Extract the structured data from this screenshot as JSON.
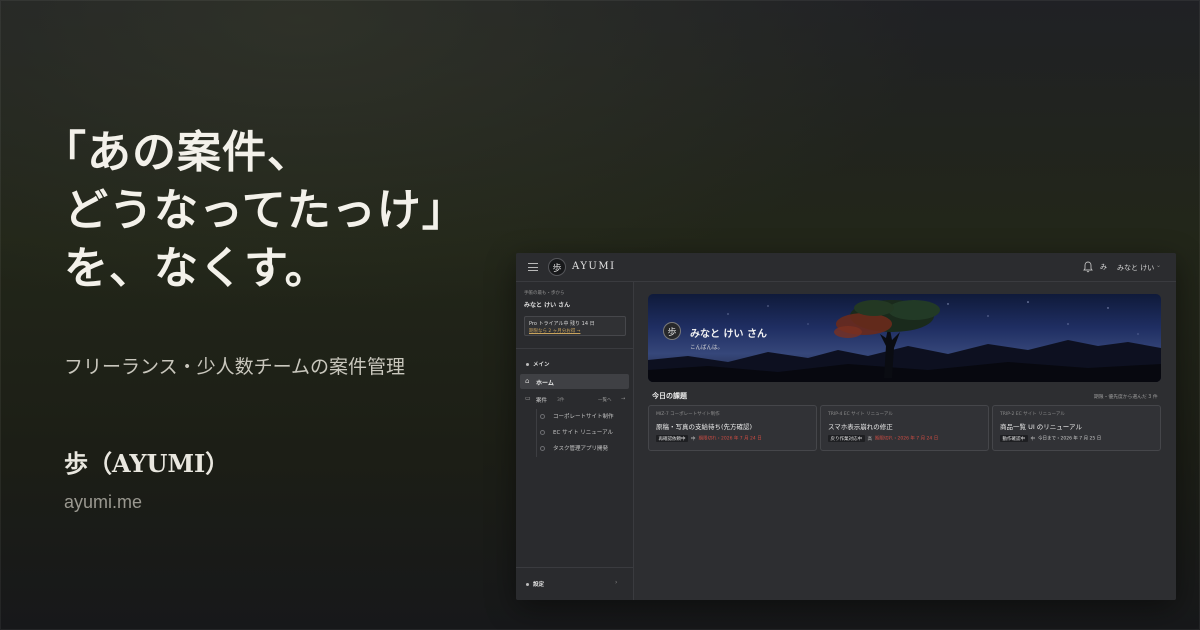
{
  "promo": {
    "headline": [
      "「あの案件、",
      "どうなってたっけ」",
      "を、なくす。"
    ],
    "subtitle": "フリーランス・少人数チームの案件管理",
    "brand": "歩（AYUMI）",
    "url": "ayumi.me"
  },
  "app": {
    "topbar": {
      "logo_glyph": "歩",
      "logo_text": "AYUMI",
      "user_avatar": "み",
      "user_name": "みなと けい"
    },
    "sidebar": {
      "note": "手帳の最も・歩から",
      "user": "みなと けい さん",
      "trial_line1": "Pro トライアル中 残り 14 日",
      "trial_line2": "期限なら 2 ヶ月分お得 →",
      "section_main": "メイン",
      "home_label": "ホーム",
      "cases_label": "案件",
      "cases_count": "3件",
      "cases_all": "一覧へ",
      "cases_add": "→",
      "projects": [
        "コーポレートサイト制作",
        "EC サイト リニューアル",
        "タスク管理アプリ開発"
      ],
      "settings_label": "設定",
      "settings_arrow": "›"
    },
    "hero": {
      "badge": "歩",
      "name": "みなと けい さん",
      "greeting": "こんばんは。"
    },
    "today": {
      "title": "今日の課題",
      "note": "期限・優先度から選んだ 3 件",
      "cards": [
        {
          "project": "MIZ-7 コーポレートサイト制作",
          "title": "原稿・写真の支給待ち(先方確認)",
          "status": "再確認依頼中",
          "priority": "中",
          "due": "期限切れ・2026 年 7 月 24 日"
        },
        {
          "project": "TRIP-4 EC サイト リニューアル",
          "title": "スマホ表示崩れの修正",
          "status": "戻り作業対応中",
          "priority": "高",
          "due": "期限切れ・2026 年 7 月 24 日"
        },
        {
          "project": "TRIP-2 EC サイト リニューアル",
          "title": "商品一覧 UI のリニューアル",
          "status": "動作確認中",
          "priority": "中",
          "due": "今日まで・2026 年 7 月 25 日"
        }
      ]
    }
  },
  "colors": {
    "overdue": "#cf4c43",
    "accent_link": "#c9a35c"
  }
}
